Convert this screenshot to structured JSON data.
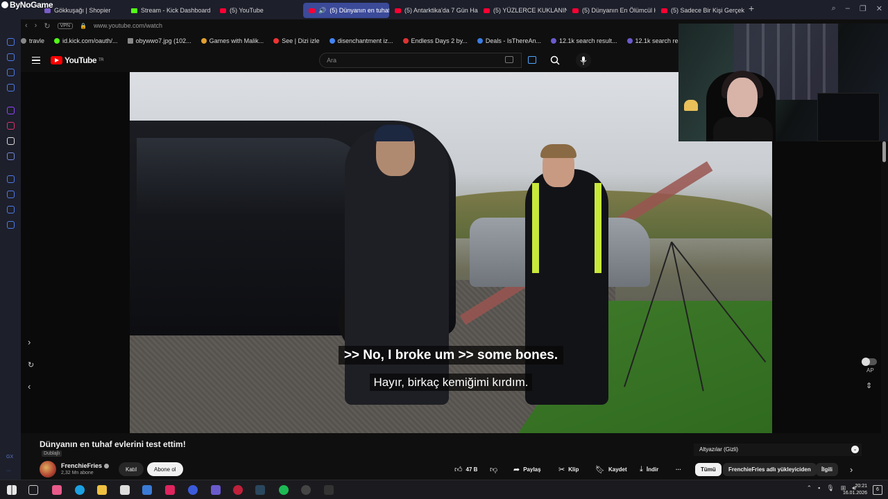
{
  "browser": {
    "brand": "ByNoGame",
    "tabs": [
      {
        "label": "Gökkuşağı | Shopier",
        "icon": "shopier-icon"
      },
      {
        "label": "Stream - Kick Dashboard",
        "icon": "kick-icon"
      },
      {
        "label": "(5) YouTube",
        "icon": "youtube-icon"
      },
      {
        "label": "(5) Dünyanın en tuhaf",
        "icon": "youtube-icon",
        "active": true
      },
      {
        "label": "(5) Antarktika'da 7 Gün Ha",
        "icon": "youtube-icon"
      },
      {
        "label": "(5) YÜZLERCE KUKLANIN",
        "icon": "youtube-icon"
      },
      {
        "label": "(5) Dünyanın En Ölümcül H",
        "icon": "youtube-icon"
      },
      {
        "label": "(5) Sadece Bir Kişi Gerçek",
        "icon": "youtube-icon"
      }
    ],
    "new_tab": "+",
    "vpn": "VPN",
    "url": "www.youtube.com/watch",
    "bookmarks": [
      {
        "label": "travle"
      },
      {
        "label": "id.kick.com/oauth/..."
      },
      {
        "label": "obywwo7.jpg (102..."
      },
      {
        "label": "Games with Malik..."
      },
      {
        "label": "See | Dizi izle"
      },
      {
        "label": "disenchantment iz..."
      },
      {
        "label": "Endless Days 2 by..."
      },
      {
        "label": "Deals - IsThereAn..."
      },
      {
        "label": "12.1k search result..."
      },
      {
        "label": "12.1k search result..."
      }
    ],
    "sidebar_footer": "GX"
  },
  "youtube": {
    "logo_text": "YouTube",
    "region": "TR",
    "search_placeholder": "Ara"
  },
  "player": {
    "subtitle_en": ">> No, I broke um >> some bones.",
    "subtitle_tr": "Hayır, birkaç kemiğimi kırdım.",
    "autoplay_label": "AP"
  },
  "video": {
    "title": "Dünyanın en tuhaf evlerini test ettim!",
    "dubbed": "Dublajlı",
    "channel": "FrenchieFries",
    "subscribers": "2,32 Mn abone",
    "join": "Katıl",
    "subscribe": "Abone ol",
    "likes": "47 B",
    "share": "Paylaş",
    "clip": "Klip",
    "save": "Kaydet",
    "download": "İndir",
    "more": "···"
  },
  "right_panel": {
    "subtitles_label": "Altyazılar (Gizli)",
    "chips": [
      "Tümü",
      "FrenchieFries adlı yükleyiciden",
      "İlgili"
    ]
  },
  "taskbar": {
    "time": "20:21",
    "date": "16.01.2026",
    "notifications": "6"
  },
  "colors": {
    "tab_active": "#3b4a99",
    "youtube_red": "#ff0000",
    "sidebar_icon": "#4f7be8"
  }
}
